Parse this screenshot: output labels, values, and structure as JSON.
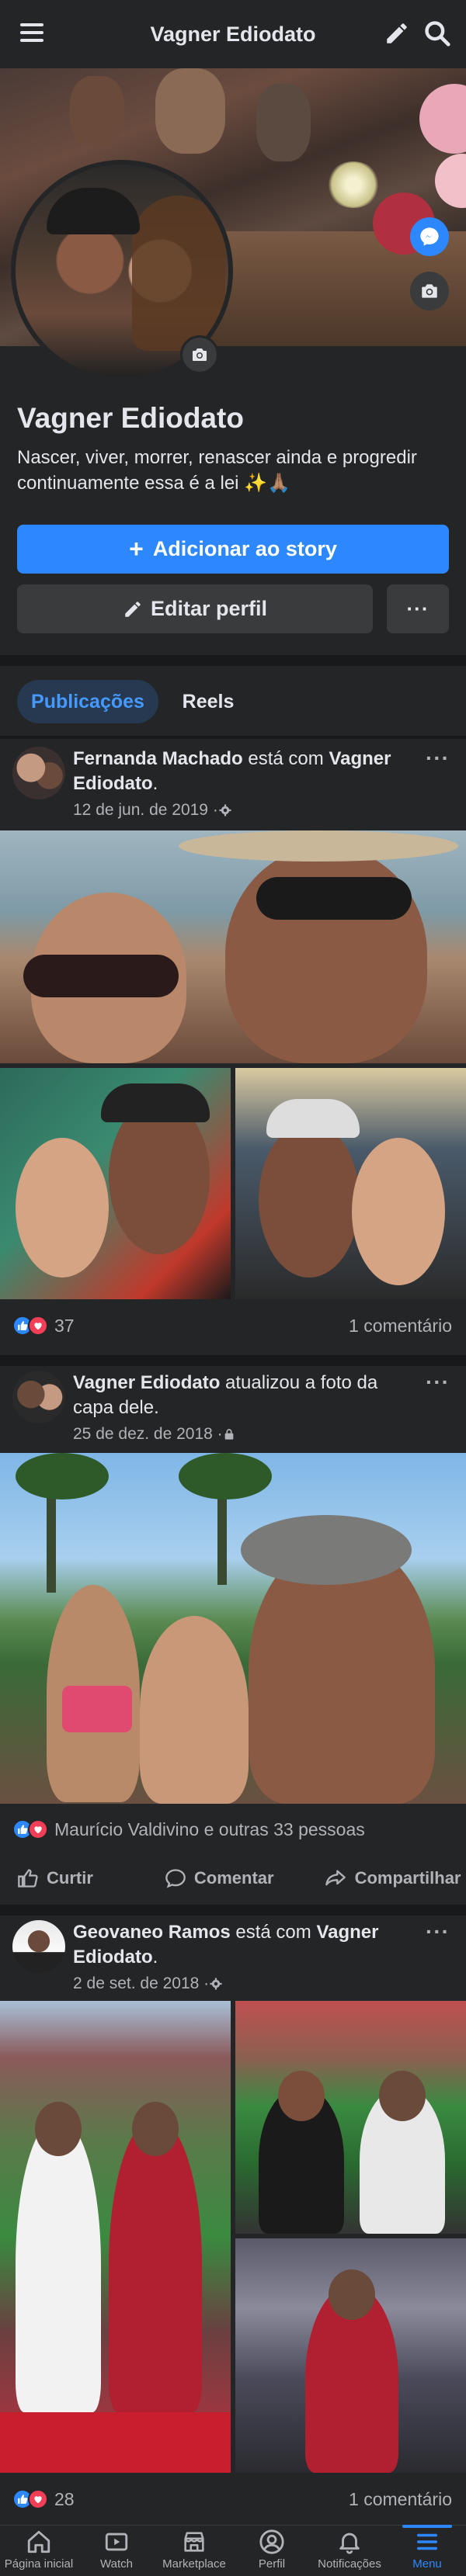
{
  "topbar": {
    "title": "Vagner Ediodato",
    "menu_icon": "hamburger-icon",
    "edit_icon": "pencil-icon",
    "search_icon": "search-icon"
  },
  "profile": {
    "name": "Vagner Ediodato",
    "bio": "Nascer, viver, morrer, renascer ainda e progredir continuamente essa é a lei ✨🙏🏽",
    "add_story_label": "Adicionar ao story",
    "edit_profile_label": "Editar perfil",
    "more_label": "···"
  },
  "tabs": [
    {
      "label": "Publicações",
      "active": true
    },
    {
      "label": "Reels",
      "active": false
    }
  ],
  "posts": [
    {
      "author": "Fernanda Machado",
      "verb": " está com ",
      "with": "Vagner Ediodato",
      "suffix": ".",
      "date": "12 de jun. de 2019 · ",
      "privacy_icon": "gear-icon",
      "reactions_count": "37",
      "comments": "1 comentário"
    },
    {
      "author": "Vagner Ediodato",
      "verb": " atualizou a foto da capa dele.",
      "date": "25 de dez. de 2018 · ",
      "privacy_icon": "lock-icon",
      "reactions_text": "Maurício Valdivino e outras 33 pessoas",
      "actions": {
        "like": "Curtir",
        "comment": "Comentar",
        "share": "Compartilhar"
      }
    },
    {
      "author": "Geovaneo Ramos",
      "verb": " está com ",
      "with": "Vagner Ediodato",
      "suffix": ".",
      "date": "2 de set. de 2018 · ",
      "privacy_icon": "gear-icon",
      "reactions_count": "28",
      "comments": "1 comentário"
    }
  ],
  "bottom_nav": [
    {
      "label": "Página inicial",
      "icon": "home-icon"
    },
    {
      "label": "Watch",
      "icon": "watch-icon"
    },
    {
      "label": "Marketplace",
      "icon": "marketplace-icon"
    },
    {
      "label": "Perfil",
      "icon": "profile-icon"
    },
    {
      "label": "Notificações",
      "icon": "bell-icon"
    },
    {
      "label": "Menu",
      "icon": "menu-icon",
      "active": true
    }
  ],
  "colors": {
    "background": "#242526",
    "separator": "#18191a",
    "accent": "#2d88ff",
    "text": "#e4e6eb",
    "muted": "#b0b3b8"
  }
}
